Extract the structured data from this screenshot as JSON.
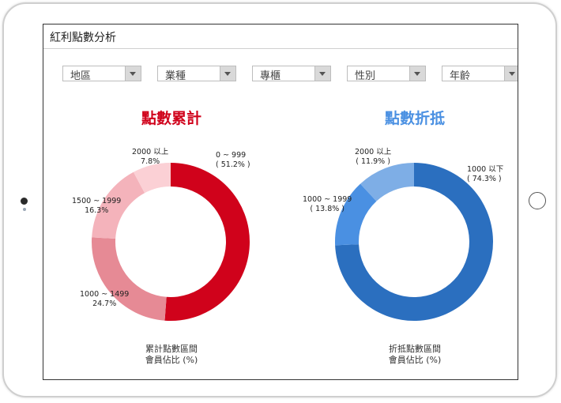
{
  "screen": {
    "title": "紅利點數分析"
  },
  "filters": [
    {
      "label": "地區"
    },
    {
      "label": "業種"
    },
    {
      "label": "專櫃"
    },
    {
      "label": "性別"
    },
    {
      "label": "年齡"
    }
  ],
  "chart_data": [
    {
      "type": "pie",
      "title": "點數累計",
      "caption_line1": "累計點數區間",
      "caption_line2": "會員佔比 (%)",
      "slices": [
        {
          "label": "0 ~ 999",
          "value": 51.2,
          "value_text": "( 51.2% )",
          "color": "#d0021b"
        },
        {
          "label": "1000 ~ 1499",
          "value": 24.7,
          "value_text": "24.7%",
          "color": "#e68a95"
        },
        {
          "label": "1500 ~ 1999",
          "value": 16.3,
          "value_text": "16.3%",
          "color": "#f4b3bb"
        },
        {
          "label": "2000 以上",
          "value": 7.8,
          "value_text": "7.8%",
          "color": "#fbd0d5"
        }
      ],
      "title_color": "#d0021b"
    },
    {
      "type": "pie",
      "title": "點數折抵",
      "caption_line1": "折抵點數區間",
      "caption_line2": "會員佔比 (%)",
      "slices": [
        {
          "label": "1000 以下",
          "value": 74.3,
          "value_text": "( 74.3% )",
          "color": "#2b6fbf"
        },
        {
          "label": "1000 ~ 1999",
          "value": 13.8,
          "value_text": "( 13.8% )",
          "color": "#4a90e2"
        },
        {
          "label": "2000 以上",
          "value": 11.9,
          "value_text": "( 11.9% )",
          "color": "#7eaee6"
        }
      ],
      "title_color": "#4a90e2"
    }
  ]
}
